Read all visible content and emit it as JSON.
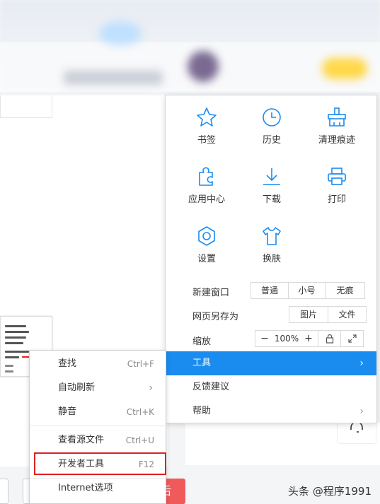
{
  "colors": {
    "accent": "#1a8cf0",
    "highlight_border": "#dd2222",
    "icon_stroke": "#1a8cf0"
  },
  "grid": [
    {
      "label": "书签",
      "icon": "star-icon"
    },
    {
      "label": "历史",
      "icon": "clock-icon"
    },
    {
      "label": "清理痕迹",
      "icon": "broom-icon"
    },
    {
      "label": "应用中心",
      "icon": "puzzle-icon"
    },
    {
      "label": "下载",
      "icon": "download-icon"
    },
    {
      "label": "打印",
      "icon": "printer-icon"
    },
    {
      "label": "设置",
      "icon": "gear-icon"
    },
    {
      "label": "换肤",
      "icon": "shirt-icon"
    }
  ],
  "new_window": {
    "label": "新建窗口",
    "options": [
      "普通",
      "小号",
      "无痕"
    ]
  },
  "save_as": {
    "label": "网页另存为",
    "options": [
      "图片",
      "文件"
    ]
  },
  "zoom": {
    "label": "缩放",
    "minus": "−",
    "value": "100%",
    "plus": "+",
    "lock_icon": "lock-icon",
    "fullscreen_icon": "expand-icon"
  },
  "menu_list": [
    {
      "label": "工具",
      "submenu": true,
      "active": true
    },
    {
      "label": "反馈建议",
      "submenu": false,
      "active": false
    },
    {
      "label": "帮助",
      "submenu": true,
      "active": false
    }
  ],
  "tools_submenu": [
    {
      "label": "查找",
      "shortcut": "Ctrl+F"
    },
    {
      "label": "自动刷新",
      "shortcut": "›"
    },
    {
      "label": "静音",
      "shortcut": "Ctrl+K"
    },
    {
      "label": "查看源文件",
      "shortcut": "Ctrl+U"
    },
    {
      "label": "开发者工具",
      "shortcut": "F12"
    },
    {
      "label": "Internet选项",
      "shortcut": ""
    }
  ],
  "watermark": "头条 @程序1991"
}
